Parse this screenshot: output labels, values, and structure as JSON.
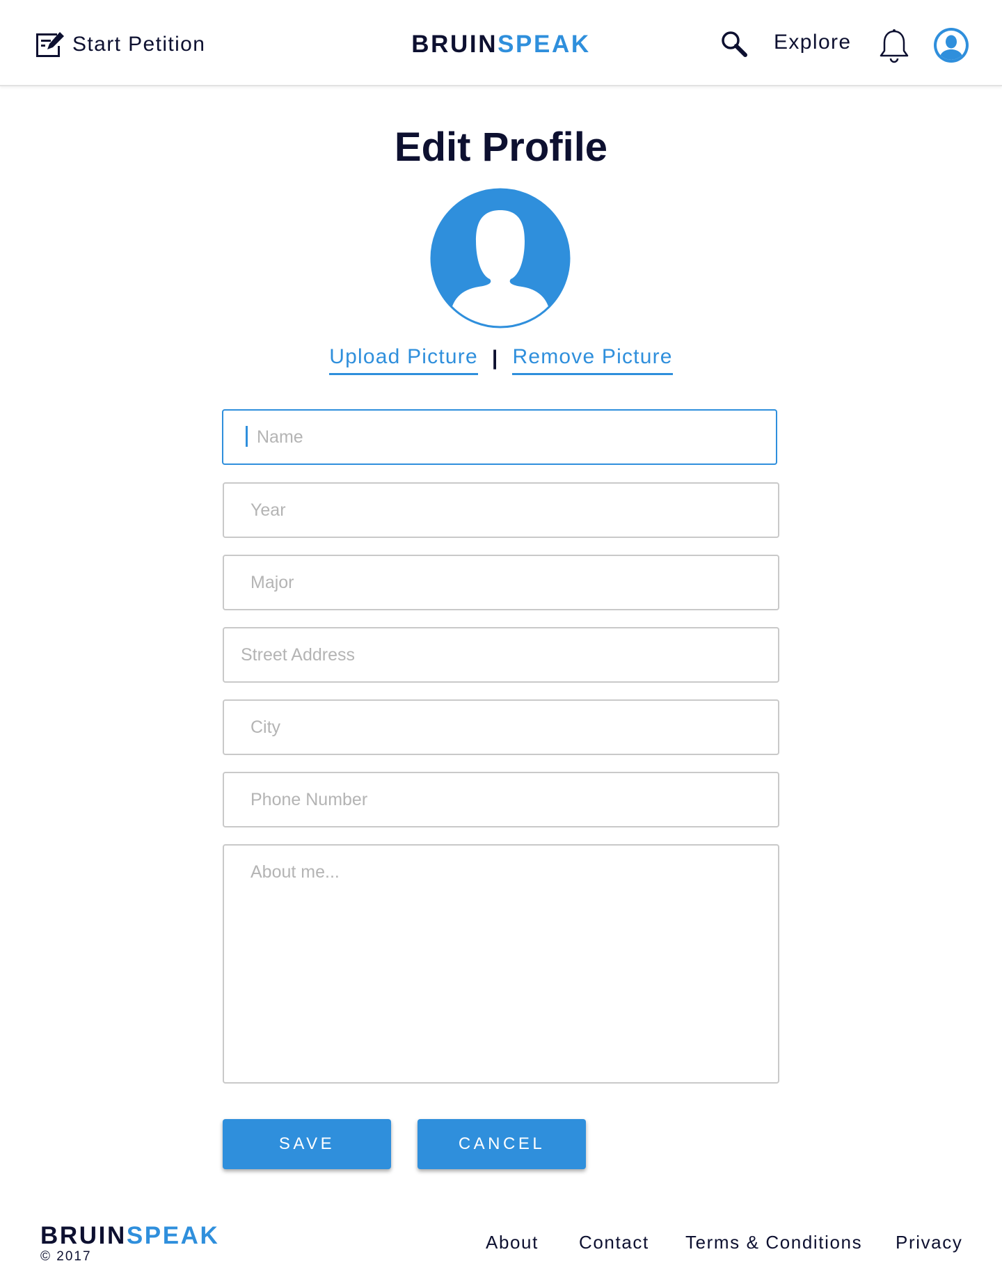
{
  "header": {
    "start_petition_label": "Start Petition",
    "brand_part1": "BRUIN",
    "brand_part2": "SPEAK",
    "explore_label": "Explore",
    "icons": {
      "start_petition": "edit-document-icon",
      "search": "search-icon",
      "notifications": "bell-icon",
      "profile": "user-avatar-icon"
    }
  },
  "main": {
    "title": "Edit Profile",
    "upload_picture_label": "Upload Picture",
    "separator": "|",
    "remove_picture_label": "Remove Picture",
    "fields": {
      "name": {
        "value": "",
        "placeholder": "Name"
      },
      "year": {
        "value": "",
        "placeholder": "Year"
      },
      "major": {
        "value": "",
        "placeholder": "Major"
      },
      "street": {
        "value": "",
        "placeholder": "Street Address"
      },
      "city": {
        "value": "",
        "placeholder": "City"
      },
      "phone": {
        "value": "",
        "placeholder": "Phone Number"
      },
      "about": {
        "value": "",
        "placeholder": "About me..."
      }
    },
    "save_label": "SAVE",
    "cancel_label": "CANCEL"
  },
  "footer": {
    "brand_part1": "BRUIN",
    "brand_part2": "SPEAK",
    "copyright": "© 2017",
    "links": [
      "About",
      "Contact",
      "Terms & Conditions",
      "Privacy"
    ]
  },
  "colors": {
    "accent": "#2f8fdc",
    "text_dark": "#0d1030",
    "placeholder": "#b4b4b4",
    "border": "#c9c9c9"
  }
}
